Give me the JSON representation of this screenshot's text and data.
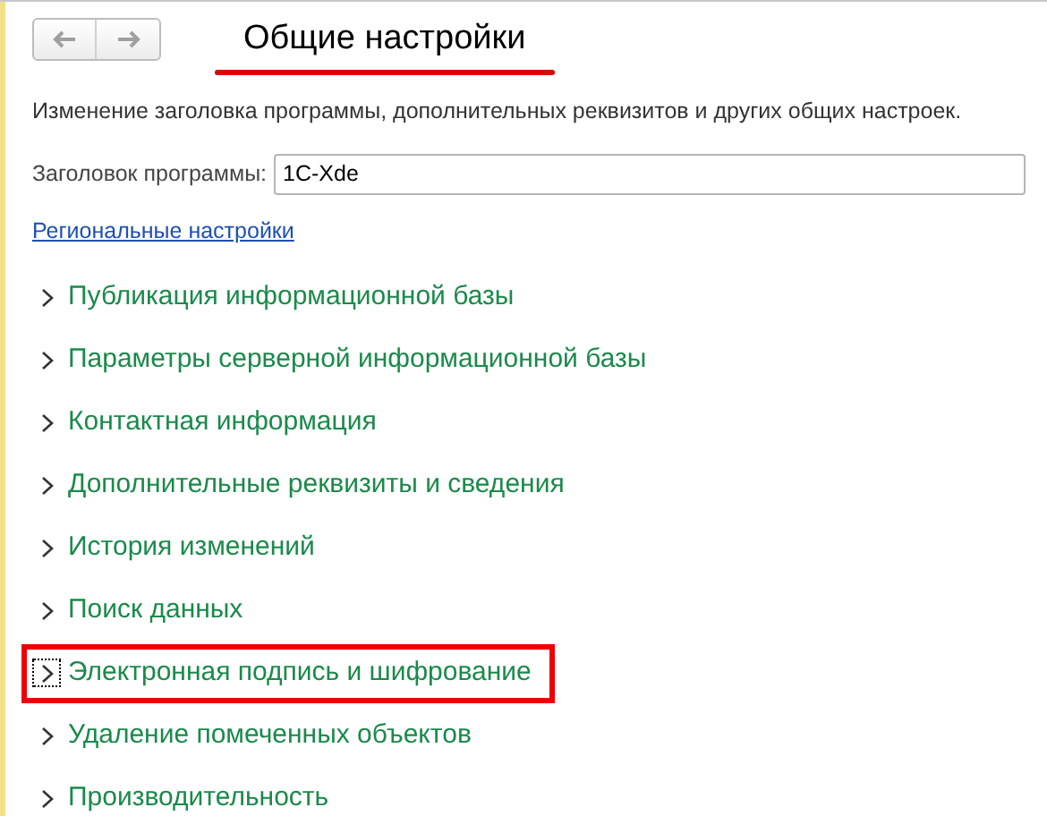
{
  "title": "Общие настройки",
  "title_underlined": true,
  "description": "Изменение заголовка программы, дополнительных реквизитов и других общих настроек.",
  "field": {
    "label": "Заголовок программы:",
    "value": "1C-Xde"
  },
  "link": "Региональные настройки",
  "sections": [
    {
      "label": "Публикация информационной базы",
      "focused": false,
      "highlighted": false
    },
    {
      "label": "Параметры серверной информационной базы",
      "focused": false,
      "highlighted": false
    },
    {
      "label": "Контактная информация",
      "focused": false,
      "highlighted": false
    },
    {
      "label": "Дополнительные реквизиты и сведения",
      "focused": false,
      "highlighted": false
    },
    {
      "label": "История изменений",
      "focused": false,
      "highlighted": false
    },
    {
      "label": "Поиск данных",
      "focused": false,
      "highlighted": false
    },
    {
      "label": "Электронная подпись и шифрование",
      "focused": true,
      "highlighted": true
    },
    {
      "label": "Удаление помеченных объектов",
      "focused": false,
      "highlighted": false
    },
    {
      "label": "Производительность",
      "focused": false,
      "highlighted": false
    }
  ]
}
